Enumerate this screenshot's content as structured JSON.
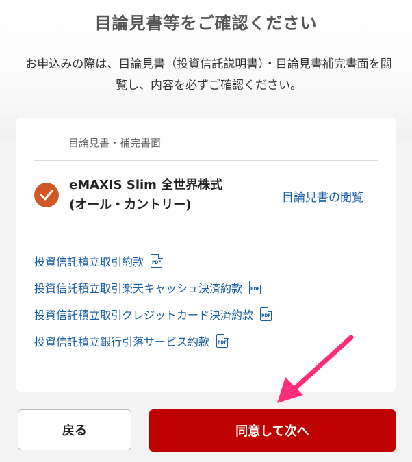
{
  "header": {
    "title": "目論見書等をご確認ください",
    "description": "お申込みの際は、目論見書（投資信託説明書）・目論見書補完書面を閲覧し、内容を必ずご確認ください。"
  },
  "card": {
    "section_label": "目論見書・補完書面",
    "fund": {
      "name_line1": "eMAXIS Slim 全世界株式",
      "name_line2": "(オール・カントリー)",
      "checked": true,
      "view_link": "目論見書の閲覧"
    },
    "documents": [
      {
        "label": "投資信託積立取引約款",
        "icon": "pdf-icon"
      },
      {
        "label": "投資信託積立取引楽天キャッシュ決済約款",
        "icon": "pdf-icon"
      },
      {
        "label": "投資信託積立取引クレジットカード決済約款",
        "icon": "pdf-icon"
      },
      {
        "label": "投資信託積立銀行引落サービス約款",
        "icon": "pdf-icon"
      }
    ],
    "pdf_icon_text": "PDF"
  },
  "footer": {
    "back_label": "戻る",
    "next_label": "同意して次へ"
  },
  "colors": {
    "accent_red": "#bf0000",
    "check_orange": "#cf5a26",
    "link_blue": "#1a5fa5",
    "annotation_arrow": "#ff2d7a"
  }
}
